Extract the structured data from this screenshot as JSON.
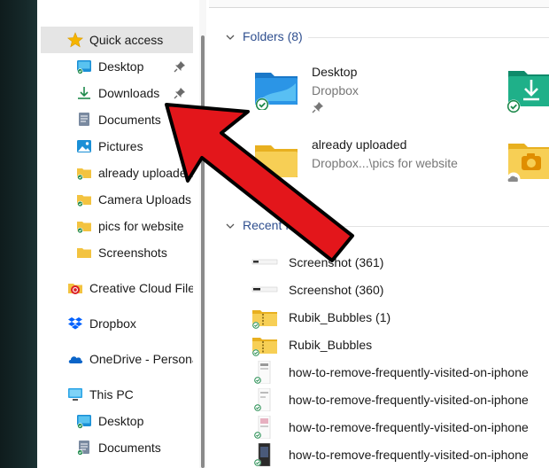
{
  "nav": {
    "items": [
      {
        "label": "Quick access",
        "icon": "star-icon",
        "pinned": false
      },
      {
        "label": "Desktop",
        "icon": "desktop-folder-icon",
        "pinned": true
      },
      {
        "label": "Downloads",
        "icon": "download-icon",
        "pinned": true
      },
      {
        "label": "Documents",
        "icon": "documents-icon",
        "pinned": true
      },
      {
        "label": "Pictures",
        "icon": "pictures-icon",
        "pinned": true
      },
      {
        "label": "already uploaded",
        "icon": "synced-folder-icon",
        "pinned": false
      },
      {
        "label": "Camera Uploads",
        "icon": "synced-folder-icon",
        "pinned": false
      },
      {
        "label": "pics for website",
        "icon": "synced-folder-icon",
        "pinned": false
      },
      {
        "label": "Screenshots",
        "icon": "folder-icon",
        "pinned": false
      },
      {
        "label": "Creative Cloud Files",
        "icon": "creative-cloud-icon",
        "pinned": false
      },
      {
        "label": "Dropbox",
        "icon": "dropbox-icon",
        "pinned": false
      },
      {
        "label": "OneDrive - Personal",
        "icon": "onedrive-icon",
        "pinned": false
      },
      {
        "label": "This PC",
        "icon": "this-pc-icon",
        "pinned": false
      },
      {
        "label": "Desktop",
        "icon": "desktop-folder-icon",
        "pinned": false
      },
      {
        "label": "Documents",
        "icon": "documents-icon",
        "pinned": false
      }
    ]
  },
  "folders": {
    "header": "Folders (8)",
    "tiles": [
      {
        "name": "Desktop",
        "sub": "Dropbox",
        "icon": "desktop-folder-icon"
      },
      {
        "name": "already uploaded",
        "sub": "Dropbox...\\pics for website",
        "icon": "folder-icon"
      }
    ]
  },
  "recent": {
    "header": "Recent files (2",
    "files": [
      {
        "name": "Screenshot (361)",
        "icon": "image-thumbnail-icon"
      },
      {
        "name": "Screenshot (360)",
        "icon": "image-thumbnail-icon"
      },
      {
        "name": "Rubik_Bubbles (1)",
        "icon": "zip-folder-icon"
      },
      {
        "name": "Rubik_Bubbles",
        "icon": "zip-folder-icon"
      },
      {
        "name": "how-to-remove-frequently-visited-on-iphone",
        "icon": "phone-screenshot-icon"
      },
      {
        "name": "how-to-remove-frequently-visited-on-iphone",
        "icon": "phone-screenshot-icon"
      },
      {
        "name": "how-to-remove-frequently-visited-on-iphone",
        "icon": "phone-screenshot-icon"
      },
      {
        "name": "how-to-remove-frequently-visited-on-iphone",
        "icon": "phone-screenshot-icon"
      }
    ]
  },
  "colors": {
    "accent": "#2f4f8f",
    "arrow_red": "#e3161b",
    "selection": "#e5e5e5",
    "sync_green": "#1f8a4c"
  }
}
